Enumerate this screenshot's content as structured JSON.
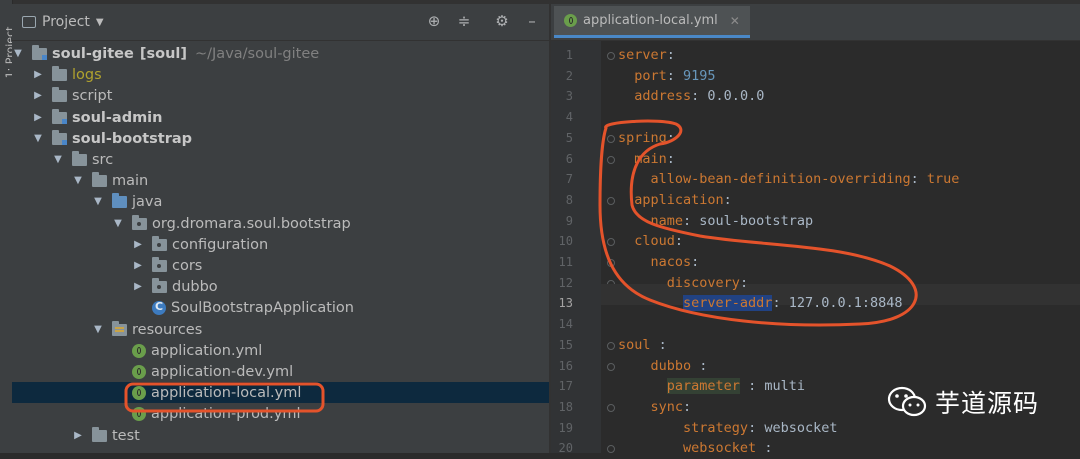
{
  "project_panel": {
    "title": "Project",
    "actions": [
      "locate-icon",
      "collapse-icon",
      "settings-icon",
      "hide-icon"
    ],
    "side_strip_label": "1: Project",
    "tree": [
      {
        "label": "soul-gitee",
        "bold": true,
        "suffix": "[soul]",
        "path": "~/Java/soul-gitee",
        "expanded": true,
        "icon": "module-folder-icon",
        "level": 0
      },
      {
        "label": "logs",
        "olive": true,
        "expanded": false,
        "icon": "folder-icon",
        "level": 1
      },
      {
        "label": "script",
        "expanded": false,
        "icon": "folder-icon",
        "level": 1
      },
      {
        "label": "soul-admin",
        "bold": true,
        "expanded": false,
        "icon": "module-folder-icon",
        "level": 1
      },
      {
        "label": "soul-bootstrap",
        "bold": true,
        "expanded": true,
        "icon": "module-folder-icon",
        "level": 1
      },
      {
        "label": "src",
        "expanded": true,
        "icon": "folder-icon",
        "level": 2
      },
      {
        "label": "main",
        "expanded": true,
        "icon": "folder-icon",
        "level": 3
      },
      {
        "label": "java",
        "expanded": true,
        "icon": "source-folder-icon",
        "level": 4
      },
      {
        "label": "org.dromara.soul.bootstrap",
        "expanded": true,
        "icon": "package-icon",
        "level": 5
      },
      {
        "label": "configuration",
        "expanded": false,
        "icon": "package-icon",
        "level": 6
      },
      {
        "label": "cors",
        "expanded": false,
        "icon": "package-icon",
        "level": 6
      },
      {
        "label": "dubbo",
        "expanded": false,
        "icon": "package-icon",
        "level": 6
      },
      {
        "label": "SoulBootstrapApplication",
        "leaf": true,
        "icon": "spring-class-icon",
        "level": 6
      },
      {
        "label": "resources",
        "expanded": true,
        "icon": "resources-folder-icon",
        "level": 4
      },
      {
        "label": "application.yml",
        "leaf": true,
        "icon": "spring-yml-icon",
        "level": 5
      },
      {
        "label": "application-dev.yml",
        "leaf": true,
        "icon": "spring-yml-icon",
        "level": 5
      },
      {
        "label": "application-local.yml",
        "leaf": true,
        "icon": "spring-yml-icon",
        "level": 5,
        "selected": true
      },
      {
        "label": "application-prod.yml",
        "leaf": true,
        "icon": "spring-yml-icon",
        "level": 5
      },
      {
        "label": "test",
        "expanded": false,
        "icon": "folder-icon",
        "level": 3
      }
    ]
  },
  "editor": {
    "tab_label": "application-local.yml",
    "current_line": 13,
    "lines": [
      {
        "n": "1",
        "tokens": [
          [
            "k",
            "server"
          ],
          [
            "v",
            ":"
          ]
        ]
      },
      {
        "n": "2",
        "tokens": [
          [
            "v",
            "  "
          ],
          [
            "k",
            "port"
          ],
          [
            "v",
            ": "
          ],
          [
            "n",
            "9195"
          ]
        ]
      },
      {
        "n": "3",
        "tokens": [
          [
            "v",
            "  "
          ],
          [
            "k",
            "address"
          ],
          [
            "v",
            ": 0.0.0.0"
          ]
        ]
      },
      {
        "n": "4",
        "tokens": []
      },
      {
        "n": "5",
        "tokens": [
          [
            "k",
            "spring"
          ],
          [
            "v",
            ":"
          ]
        ]
      },
      {
        "n": "6",
        "tokens": [
          [
            "v",
            "  "
          ],
          [
            "k",
            "main"
          ],
          [
            "v",
            ":"
          ]
        ]
      },
      {
        "n": "7",
        "tokens": [
          [
            "v",
            "    "
          ],
          [
            "k",
            "allow-bean-definition-overriding"
          ],
          [
            "v",
            ": "
          ],
          [
            "b",
            "true"
          ]
        ]
      },
      {
        "n": "8",
        "tokens": [
          [
            "v",
            "  "
          ],
          [
            "k",
            "application"
          ],
          [
            "v",
            ":"
          ]
        ]
      },
      {
        "n": "9",
        "tokens": [
          [
            "v",
            "    "
          ],
          [
            "k",
            "name"
          ],
          [
            "v",
            ": soul-bootstrap"
          ]
        ]
      },
      {
        "n": "10",
        "tokens": [
          [
            "v",
            "  "
          ],
          [
            "k",
            "cloud"
          ],
          [
            "v",
            ":"
          ]
        ]
      },
      {
        "n": "11",
        "tokens": [
          [
            "v",
            "    "
          ],
          [
            "k",
            "nacos"
          ],
          [
            "v",
            ":"
          ]
        ]
      },
      {
        "n": "12",
        "tokens": [
          [
            "v",
            "      "
          ],
          [
            "k",
            "discovery"
          ],
          [
            "v",
            ":"
          ]
        ]
      },
      {
        "n": "13",
        "tokens": [
          [
            "v",
            "        "
          ],
          [
            "ksel",
            "server-addr"
          ],
          [
            "v",
            ": 127.0.0.1:8848"
          ]
        ]
      },
      {
        "n": "14",
        "tokens": []
      },
      {
        "n": "15",
        "tokens": [
          [
            "k",
            "soul"
          ],
          [
            "v",
            " :"
          ]
        ]
      },
      {
        "n": "16",
        "tokens": [
          [
            "v",
            "    "
          ],
          [
            "k",
            "dubbo"
          ],
          [
            "v",
            " :"
          ]
        ]
      },
      {
        "n": "17",
        "tokens": [
          [
            "v",
            "      "
          ],
          [
            "kparam",
            "parameter"
          ],
          [
            "v",
            " : multi"
          ]
        ]
      },
      {
        "n": "18",
        "tokens": [
          [
            "v",
            "    "
          ],
          [
            "k",
            "sync"
          ],
          [
            "v",
            ":"
          ]
        ]
      },
      {
        "n": "19",
        "tokens": [
          [
            "v",
            "        "
          ],
          [
            "k",
            "strategy"
          ],
          [
            "v",
            ": websocket"
          ]
        ]
      },
      {
        "n": "20",
        "tokens": [
          [
            "v",
            "        "
          ],
          [
            "k",
            "websocket"
          ],
          [
            "v",
            " :"
          ]
        ]
      }
    ]
  },
  "watermark": {
    "text": "芋道源码",
    "icon": "wechat-icon"
  },
  "colors": {
    "annotation": "#e4532b",
    "selection": "#0d293e",
    "tab_underline": "#4a88c7"
  }
}
